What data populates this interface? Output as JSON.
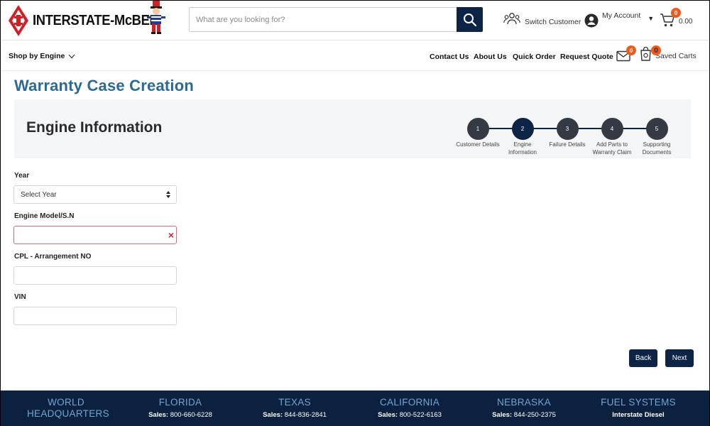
{
  "header": {
    "logo_text": "INTERSTATE-McBEE",
    "search_placeholder": "What are you looking for?",
    "switch_customer": "Switch Customer",
    "my_account": "My Account",
    "cart_total": "0.00",
    "cart_count": "0"
  },
  "nav": {
    "shop_by": "Shop by Engine",
    "links": [
      "Contact Us",
      "About Us",
      "Quick Order",
      "Request Quote"
    ],
    "message_count": "0",
    "saved_carts_count": "0",
    "saved_carts": "Saved Carts"
  },
  "page_title": "Warranty Case Creation",
  "section_title": "Engine Information",
  "steps": [
    {
      "num": "1",
      "label_1": "Customer Details",
      "label_2": "",
      "active": false
    },
    {
      "num": "2",
      "label_1": "Engine",
      "label_2": "Information",
      "active": true
    },
    {
      "num": "3",
      "label_1": "Failure Details",
      "label_2": "",
      "active": false
    },
    {
      "num": "4",
      "label_1": "Add Parts to",
      "label_2": "Warranty Claim",
      "active": false
    },
    {
      "num": "5",
      "label_1": "Supporting",
      "label_2": "Documents",
      "active": false
    }
  ],
  "form": {
    "year_label": "Year",
    "year_value": "Select Year",
    "engine_label": "Engine Model/S.N",
    "engine_value": "",
    "cpl_label": "CPL - Arrangement NO",
    "cpl_value": "",
    "vin_label": "VIN",
    "vin_value": ""
  },
  "buttons": {
    "back": "Back",
    "next": "Next"
  },
  "footer": [
    {
      "region": "WORLD HEADQUARTERS",
      "sales_label": "",
      "sales_value": ""
    },
    {
      "region": "FLORIDA",
      "sales_label": "Sales:",
      "sales_value": "800-660-6228"
    },
    {
      "region": "TEXAS",
      "sales_label": "Sales:",
      "sales_value": "844-836-2841"
    },
    {
      "region": "CALIFORNIA",
      "sales_label": "Sales:",
      "sales_value": "800-522-6163"
    },
    {
      "region": "NEBRASKA",
      "sales_label": "Sales:",
      "sales_value": "844-250-2375"
    },
    {
      "region": "FUEL SYSTEMS",
      "sales_label": "Interstate Diesel",
      "sales_value": ""
    }
  ],
  "colors": {
    "brand_navy": "#0d2447",
    "title_blue": "#2c6a93",
    "badge_orange": "#f05a1e",
    "logo_red": "#d21f26",
    "error_red": "#e06a74",
    "footer_bg": "#0c213f",
    "footer_region": "#6fa5d2"
  },
  "icons": {
    "search": "search-icon",
    "switch_customer": "people-icon",
    "account": "user-circle-icon",
    "cart": "cart-icon",
    "messages": "envelope-icon",
    "saved_carts": "saved-cart-icon",
    "dropdown": "chevron-down-icon",
    "select": "select-arrows-icon",
    "error": "error-x-icon"
  }
}
